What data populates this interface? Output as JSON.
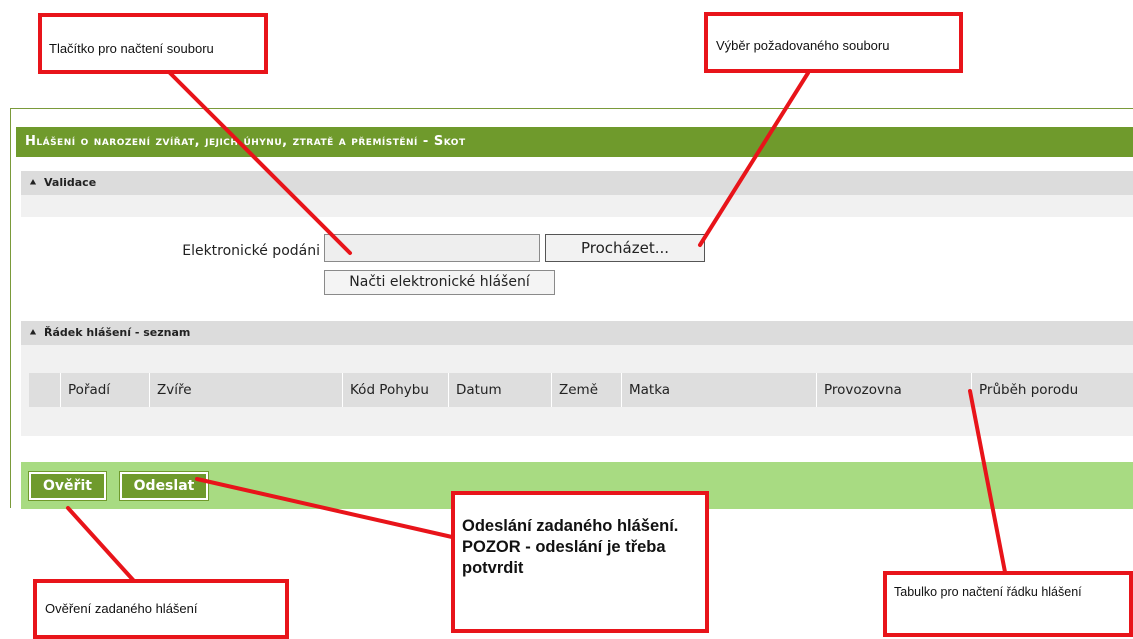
{
  "form": {
    "title": "Hlášení o narození zvířat, jejich úhynu, ztratě a přemístění - Skot",
    "validation_section": "Validace",
    "upload_label": "Elektronické podáni",
    "browse_label": "Procházet...",
    "load_label": "Načti elektronické hlášení",
    "list_section": "Řádek hlášení - seznam",
    "columns": [
      "Pořadí",
      "Zvíře",
      "Kód Pohybu",
      "Datum",
      "Země",
      "Matka",
      "Provozovna",
      "Průběh porodu"
    ],
    "verify_label": "Ověřit",
    "send_label": "Odeslat",
    "section_icon": "double-chevron-up-icon"
  },
  "annotations": {
    "load_button_note": "Tlačítko pro načtení souboru",
    "browse_note": "Výběr požadovaného souboru",
    "send_note": "Odeslání zadaného hlášení. POZOR - odeslání je třeba potvrdit",
    "verify_note": "Ověření zadaného hlášení",
    "table_note": "Tabulko pro načtení řádku hlášení"
  },
  "colors": {
    "header_green": "#6f9a2c",
    "action_bar_green": "#a8db82",
    "callout_red": "#e8141a"
  }
}
